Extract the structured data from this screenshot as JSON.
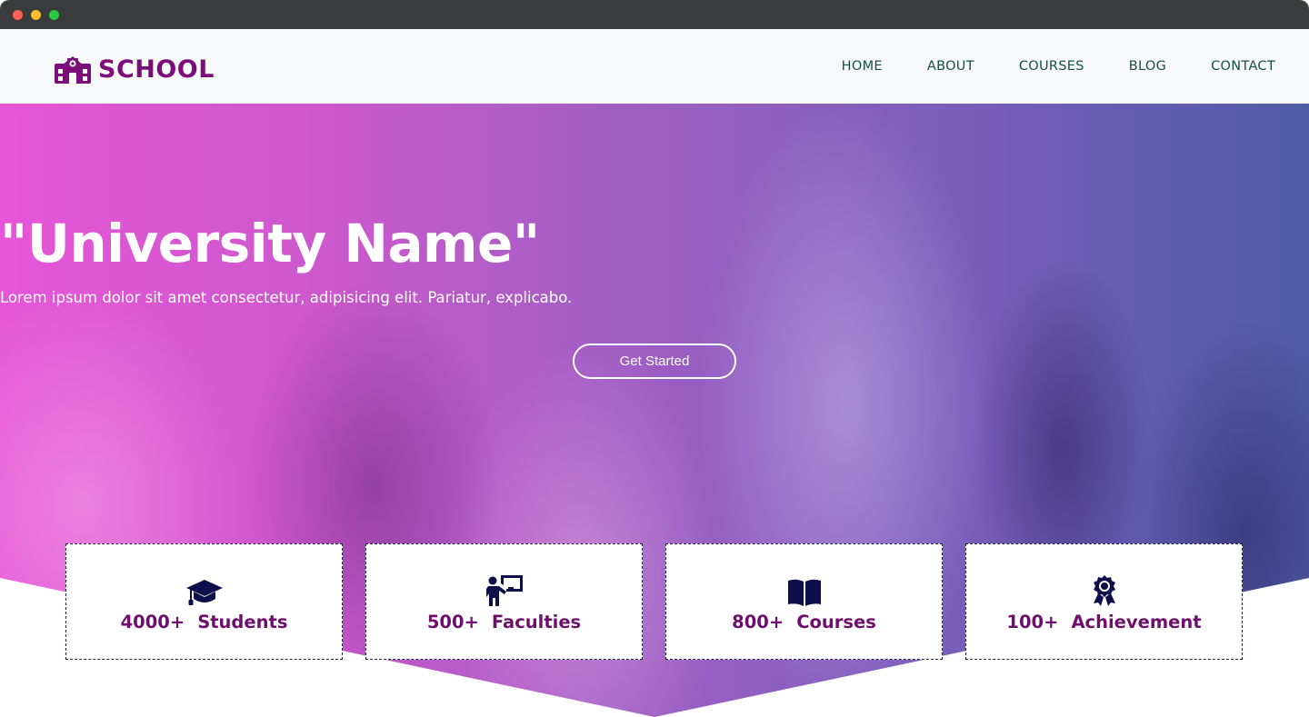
{
  "brand": {
    "name": "SCHOOL",
    "icon": "school-building-icon",
    "color": "#7b0e78"
  },
  "nav": {
    "items": [
      {
        "label": "HOME"
      },
      {
        "label": "ABOUT"
      },
      {
        "label": "COURSES"
      },
      {
        "label": "BLOG"
      },
      {
        "label": "CONTACT"
      }
    ],
    "color": "#14503f"
  },
  "hero": {
    "title": "\"University Name\"",
    "subtitle": "Lorem ipsum dolor sit amet consectetur, adipisicing elit. Pariatur, explicabo.",
    "cta_label": "Get Started",
    "gradient": [
      "#e656d8",
      "#4f5ba8"
    ]
  },
  "stats": [
    {
      "value": "4000+",
      "label": "Students",
      "icon": "graduation-cap-icon"
    },
    {
      "value": "500+",
      "label": "Faculties",
      "icon": "teacher-board-icon"
    },
    {
      "value": "800+",
      "label": "Courses",
      "icon": "open-book-icon"
    },
    {
      "value": "100+",
      "label": "Achievement",
      "icon": "award-ribbon-icon"
    }
  ],
  "stat_colors": {
    "text": "#6f0f6c",
    "icon": "#0d0f4a"
  }
}
